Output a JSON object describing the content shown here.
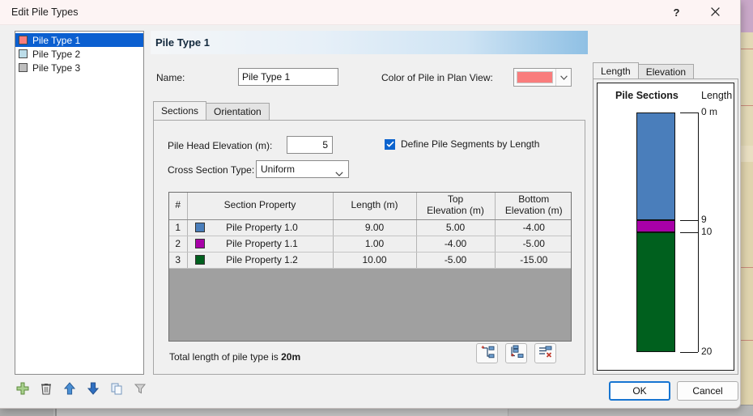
{
  "window": {
    "title": "Edit Pile Types",
    "help_label": "?",
    "close_label": "close-icon"
  },
  "sidebar": {
    "items": [
      {
        "label": "Pile Type 1",
        "color": "#f97d7d",
        "selected": true
      },
      {
        "label": "Pile Type 2",
        "color": "#bcdde9",
        "selected": false
      },
      {
        "label": "Pile Type 3",
        "color": "#bebebe",
        "selected": false
      }
    ],
    "toolbar": [
      {
        "name": "add-icon",
        "tooltip": "Add"
      },
      {
        "name": "delete-icon",
        "tooltip": "Delete"
      },
      {
        "name": "move-up-icon",
        "tooltip": "Move Up"
      },
      {
        "name": "move-down-icon",
        "tooltip": "Move Down"
      },
      {
        "name": "duplicate-icon",
        "tooltip": "Duplicate"
      },
      {
        "name": "filter-icon",
        "tooltip": "Filter"
      }
    ]
  },
  "main": {
    "header_title": "Pile Type 1",
    "name_label": "Name:",
    "name_value": "Pile Type 1",
    "color_label": "Color of Pile in Plan View:",
    "color_value": "#f97d7d",
    "tabs": [
      {
        "label": "Sections",
        "active": true
      },
      {
        "label": "Orientation",
        "active": false
      }
    ],
    "pile_head_elevation_label": "Pile Head Elevation (m):",
    "pile_head_elevation_value": "5",
    "cross_section_type_label": "Cross Section Type:",
    "cross_section_type_value": "Uniform",
    "cross_section_type_options": [
      "Uniform"
    ],
    "define_by_length_label": "Define Pile Segments by Length",
    "define_by_length_checked": true,
    "total_length_prefix": "Total length of pile type is ",
    "total_length_value": "20m",
    "grid_buttons": [
      {
        "name": "insert-section-above-icon",
        "tooltip": "Insert Section Above"
      },
      {
        "name": "insert-section-below-icon",
        "tooltip": "Insert Section Below"
      },
      {
        "name": "delete-section-icon",
        "tooltip": "Delete Section"
      }
    ]
  },
  "table": {
    "columns": [
      "#",
      "Section Property",
      "Length (m)",
      "Top\nElevation (m)",
      "Bottom\nElevation (m)"
    ],
    "columns_flat": [
      "#",
      "Section Property",
      "Length (m)",
      "Top Elevation (m)",
      "Bottom Elevation (m)"
    ],
    "rows": [
      {
        "index": "1",
        "color": "#4a7ebb",
        "property": "Pile Property 1.0",
        "length": "9.00",
        "top": "5.00",
        "bottom": "-4.00"
      },
      {
        "index": "2",
        "color": "#a800a8",
        "property": "Pile Property 1.1",
        "length": "1.00",
        "top": "-4.00",
        "bottom": "-5.00"
      },
      {
        "index": "3",
        "color": "#00601e",
        "property": "Pile Property 1.2",
        "length": "10.00",
        "top": "-5.00",
        "bottom": "-15.00"
      }
    ]
  },
  "preview": {
    "tabs": [
      {
        "label": "Length",
        "active": true
      },
      {
        "label": "Elevation",
        "active": false
      }
    ],
    "title": "Pile Sections",
    "axis_title": "Length"
  },
  "chart_data": {
    "type": "bar",
    "title": "Pile Sections",
    "xlabel": "",
    "ylabel": "Length",
    "orientation": "vertical-stacked",
    "axis_ticks": [
      "0 m",
      "9",
      "10",
      "20"
    ],
    "axis_tick_values": [
      0,
      9,
      10,
      20
    ],
    "ylim": [
      0,
      20
    ],
    "grid": false,
    "legend": "none",
    "segments": [
      {
        "name": "Pile Property 1.0",
        "start": 0,
        "end": 9,
        "length": 9,
        "color": "#4a7ebb"
      },
      {
        "name": "Pile Property 1.1",
        "start": 9,
        "end": 10,
        "length": 1,
        "color": "#a800a8"
      },
      {
        "name": "Pile Property 1.2",
        "start": 10,
        "end": 20,
        "length": 10,
        "color": "#00601e"
      }
    ]
  },
  "footer": {
    "ok_label": "OK",
    "cancel_label": "Cancel"
  }
}
